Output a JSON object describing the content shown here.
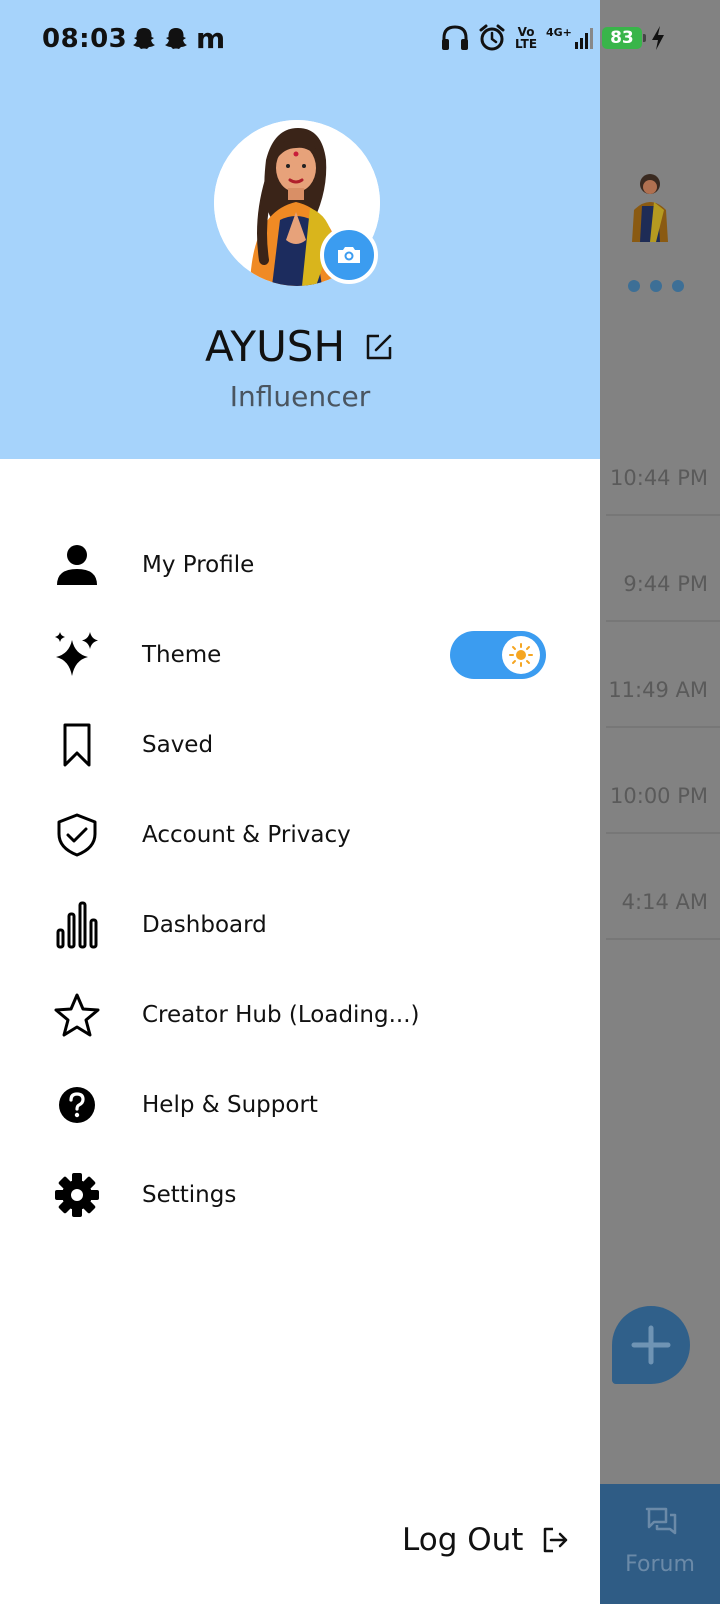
{
  "status_bar": {
    "time": "08:03",
    "notification_icons": [
      "snapchat-icon",
      "snapchat-icon",
      "m-icon"
    ],
    "notif_m": "m",
    "volte": "Vo LTE",
    "network": "4G+",
    "battery": "83"
  },
  "profile": {
    "name": "AYUSH",
    "role": "Influencer"
  },
  "menu": {
    "items": [
      {
        "label": "My Profile",
        "icon": "person-icon"
      },
      {
        "label": "Theme",
        "icon": "sparkle-icon"
      },
      {
        "label": "Saved",
        "icon": "bookmark-icon"
      },
      {
        "label": "Account & Privacy",
        "icon": "shield-check-icon"
      },
      {
        "label": "Dashboard",
        "icon": "bar-chart-icon"
      },
      {
        "label": "Creator Hub (Loading...)",
        "icon": "star-icon"
      },
      {
        "label": "Help & Support",
        "icon": "help-circle-icon"
      },
      {
        "label": "Settings",
        "icon": "gear-icon"
      }
    ],
    "theme_toggle_on": true
  },
  "logout": {
    "label": "Log Out"
  },
  "background": {
    "timestamps": [
      "10:44 PM",
      "9:44 PM",
      "11:49 AM",
      "10:00 PM",
      "4:14 AM"
    ],
    "bottom_nav_label": "Forum"
  },
  "colors": {
    "header": "#a6d3fb",
    "accent": "#3b9cf0",
    "scrim": "#828282"
  }
}
